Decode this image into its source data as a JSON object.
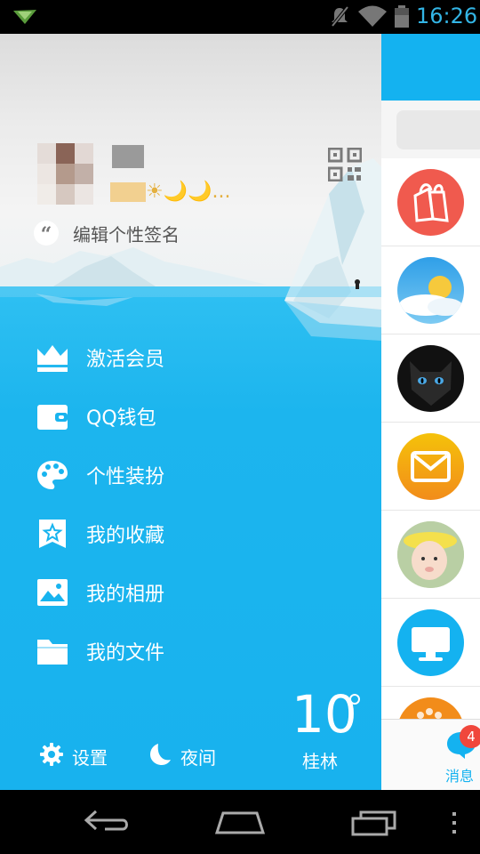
{
  "status_bar": {
    "time": "16:26",
    "icons": [
      "app-notification-icon",
      "mute-icon",
      "wifi-icon",
      "battery-icon"
    ]
  },
  "drawer": {
    "signature_quote": "“",
    "signature_placeholder": "编辑个性签名",
    "nickname_suffix": "☀🌙🌙...",
    "menu": [
      {
        "label": "激活会员",
        "icon": "crown-icon"
      },
      {
        "label": "QQ钱包",
        "icon": "wallet-icon"
      },
      {
        "label": "个性装扮",
        "icon": "palette-icon"
      },
      {
        "label": "我的收藏",
        "icon": "favorites-star-icon"
      },
      {
        "label": "我的相册",
        "icon": "photo-album-icon"
      },
      {
        "label": "我的文件",
        "icon": "folder-icon"
      }
    ],
    "settings_label": "设置",
    "night_label": "夜间",
    "weather": {
      "temp": "10",
      "city": "桂林"
    }
  },
  "chat_list": {
    "badge_count": "4",
    "tab_label": "消息",
    "avatars": [
      "shopping-bag-icon",
      "weather-icon",
      "cat-avatar",
      "mail-icon",
      "baby-avatar",
      "computer-icon",
      "orange-app-icon"
    ]
  },
  "colors": {
    "accent": "#18b4ef",
    "badge": "#f0473c"
  }
}
